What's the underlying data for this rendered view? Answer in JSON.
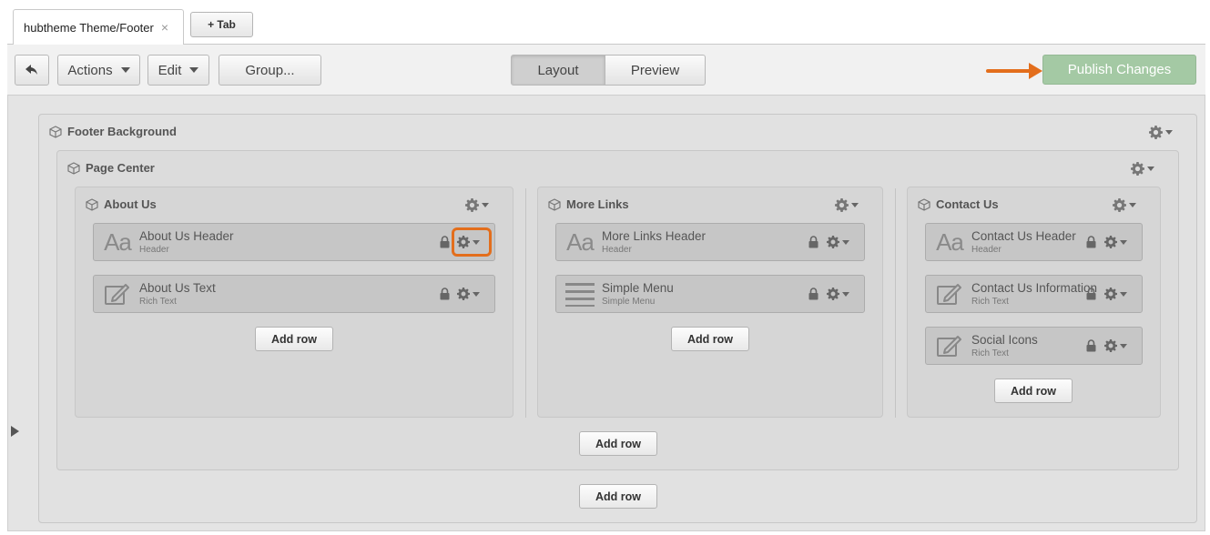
{
  "tabs": {
    "active_tab": "hubtheme Theme/Footer",
    "close_glyph": "×",
    "add_tab_label": "+ Tab"
  },
  "toolbar": {
    "back_icon": "reply-arrow-icon",
    "actions_label": "Actions",
    "edit_label": "Edit",
    "group_label": "Group...",
    "layout_label": "Layout",
    "preview_label": "Preview",
    "publish_label": "Publish Changes"
  },
  "footer_background": {
    "title": "Footer Background",
    "page_center": {
      "title": "Page Center",
      "columns": [
        {
          "title": "About Us",
          "modules": [
            {
              "name": "About Us Header",
              "type": "Header",
              "icon": "text-aa-icon"
            },
            {
              "name": "About Us Text",
              "type": "Rich Text",
              "icon": "edit-pencil-icon"
            }
          ],
          "add_row": "Add row"
        },
        {
          "title": "More Links",
          "modules": [
            {
              "name": "More Links Header",
              "type": "Header",
              "icon": "text-aa-icon"
            },
            {
              "name": "Simple Menu",
              "type": "Simple Menu",
              "icon": "menu-lines-icon"
            }
          ],
          "add_row": "Add row"
        },
        {
          "title": "Contact Us",
          "modules": [
            {
              "name": "Contact Us Header",
              "type": "Header",
              "icon": "text-aa-icon"
            },
            {
              "name": "Contact Us Information",
              "type": "Rich Text",
              "icon": "edit-pencil-icon"
            },
            {
              "name": "Social Icons",
              "type": "Rich Text",
              "icon": "edit-pencil-icon"
            }
          ],
          "add_row": "Add row"
        }
      ],
      "add_row": "Add row"
    },
    "add_row": "Add row"
  },
  "colors": {
    "accent_orange": "#e36e1c",
    "publish_green": "#a4c9a4"
  }
}
